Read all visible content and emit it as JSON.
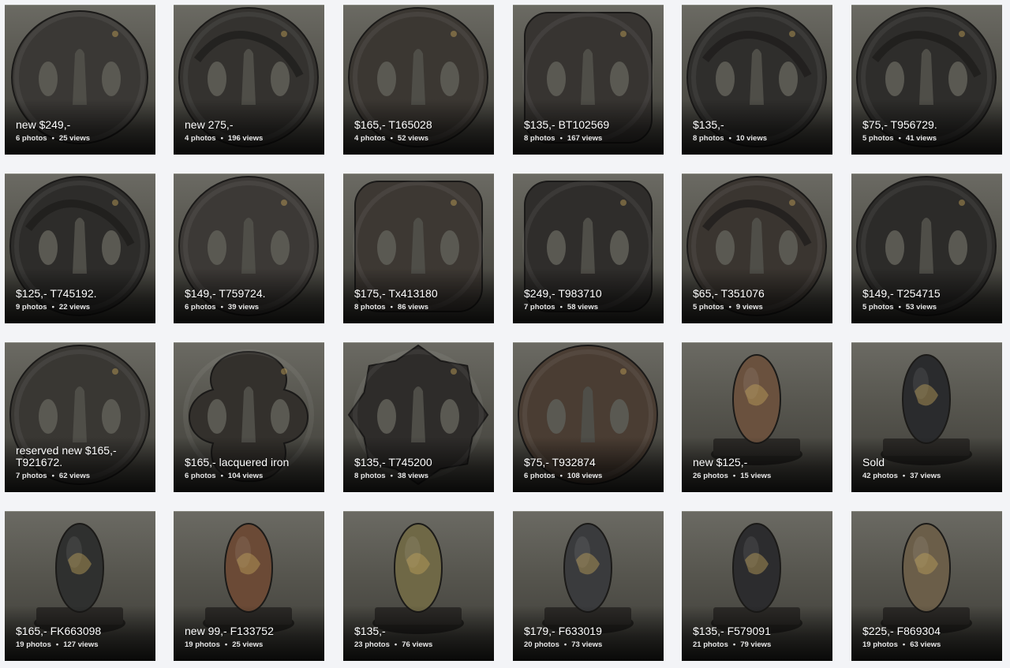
{
  "gallery": {
    "items": [
      {
        "title": "new $249,-",
        "photos": "6 photos",
        "views": "25 views",
        "kind": "tsuba-oval",
        "tone": "#3a3835"
      },
      {
        "title": "new 275,-",
        "photos": "4 photos",
        "views": "196 views",
        "kind": "tsuba-dragon",
        "tone": "#34322f"
      },
      {
        "title": "$165,- T165028",
        "photos": "4 photos",
        "views": "52 views",
        "kind": "tsuba-round",
        "tone": "#3b3732"
      },
      {
        "title": "$135,- BT102569",
        "photos": "8 photos",
        "views": "167 views",
        "kind": "tsuba-square",
        "tone": "#373431"
      },
      {
        "title": "$135,-",
        "photos": "8 photos",
        "views": "10 views",
        "kind": "tsuba-ship",
        "tone": "#2f2e2c"
      },
      {
        "title": "$75,- T956729.",
        "photos": "5 photos",
        "views": "41 views",
        "kind": "tsuba-openwork",
        "tone": "#2e2d2b"
      },
      {
        "title": "$125,- T745192.",
        "photos": "9 photos",
        "views": "22 views",
        "kind": "tsuba-fan",
        "tone": "#2d2c2a"
      },
      {
        "title": "$149,- T759724.",
        "photos": "6 photos",
        "views": "39 views",
        "kind": "tsuba-round",
        "tone": "#3c3936"
      },
      {
        "title": "$175,- Tx413180",
        "photos": "8 photos",
        "views": "86 views",
        "kind": "tsuba-square",
        "tone": "#3d3833"
      },
      {
        "title": "$249,- T983710",
        "photos": "7 photos",
        "views": "58 views",
        "kind": "tsuba-square",
        "tone": "#2f2d2b"
      },
      {
        "title": "$65,- T351076",
        "photos": "5 photos",
        "views": "9 views",
        "kind": "tsuba-openwork",
        "tone": "#3a3530"
      },
      {
        "title": "$149,- T254715",
        "photos": "5 photos",
        "views": "53 views",
        "kind": "tsuba-round",
        "tone": "#2c2b29"
      },
      {
        "title": "reserved new $165,- T921672.",
        "photos": "7 photos",
        "views": "62 views",
        "kind": "tsuba-round",
        "tone": "#393733"
      },
      {
        "title": "$165,- lacquered iron",
        "photos": "6 photos",
        "views": "104 views",
        "kind": "tsuba-mokko",
        "tone": "#33302c"
      },
      {
        "title": "$135,- T745200",
        "photos": "8 photos",
        "views": "38 views",
        "kind": "tsuba-gear",
        "tone": "#2e2c2a"
      },
      {
        "title": "$75,- T932874",
        "photos": "6 photos",
        "views": "108 views",
        "kind": "tsuba-round",
        "tone": "#4a3d33"
      },
      {
        "title": "new $125,-",
        "photos": "26 photos",
        "views": "15 views",
        "kind": "kashira",
        "tone": "#6a513e"
      },
      {
        "title": "Sold",
        "photos": "42 photos",
        "views": "37 views",
        "kind": "kashira",
        "tone": "#2a2b2d"
      },
      {
        "title": "$165,- FK663098",
        "photos": "19 photos",
        "views": "127 views",
        "kind": "kashira",
        "tone": "#2f302f"
      },
      {
        "title": "new 99,- F133752",
        "photos": "19 photos",
        "views": "25 views",
        "kind": "kashira",
        "tone": "#6b4a36"
      },
      {
        "title": "$135,-",
        "photos": "23 photos",
        "views": "76 views",
        "kind": "kashira",
        "tone": "#6f6846"
      },
      {
        "title": "$179,- F633019",
        "photos": "20 photos",
        "views": "73 views",
        "kind": "kashira",
        "tone": "#3a3b3d"
      },
      {
        "title": "$135,- F579091",
        "photos": "21 photos",
        "views": "79 views",
        "kind": "kashira",
        "tone": "#2c2c2e"
      },
      {
        "title": "$225,- F869304",
        "photos": "19 photos",
        "views": "63 views",
        "kind": "kashira",
        "tone": "#6b5e49"
      }
    ],
    "dot": "•"
  }
}
